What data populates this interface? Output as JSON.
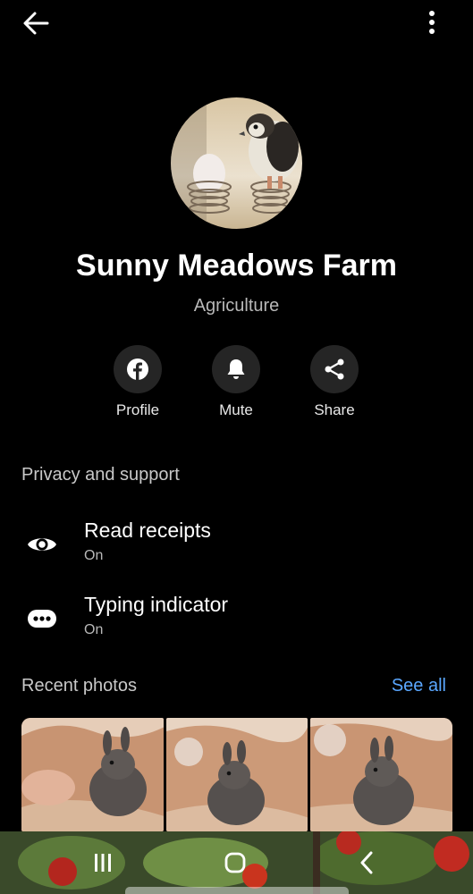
{
  "header": {
    "back_icon": "arrow-left-icon",
    "more_icon": "more-vertical-icon"
  },
  "profile": {
    "name": "Sunny Meadows Farm",
    "category": "Agriculture",
    "avatar_icon": "chick-and-egg-photo"
  },
  "actions": [
    {
      "label": "Profile",
      "icon": "facebook-icon"
    },
    {
      "label": "Mute",
      "icon": "bell-icon"
    },
    {
      "label": "Share",
      "icon": "share-icon"
    }
  ],
  "privacy": {
    "title": "Privacy and support",
    "items": [
      {
        "title": "Read receipts",
        "status": "On",
        "icon": "eye-icon"
      },
      {
        "title": "Typing indicator",
        "status": "On",
        "icon": "typing-dots-icon"
      }
    ]
  },
  "recent_photos": {
    "title": "Recent photos",
    "see_all": "See all",
    "photos": [
      "bunny-photo",
      "bunny-photo",
      "bunny-photo"
    ]
  },
  "colors": {
    "background": "#000000",
    "link": "#5aa7ff",
    "button_bg": "#252525",
    "secondary_text": "#b8b8b8"
  },
  "system_nav": {
    "recents_icon": "recents-icon",
    "home_icon": "home-icon",
    "back_icon": "back-chevron-icon"
  }
}
